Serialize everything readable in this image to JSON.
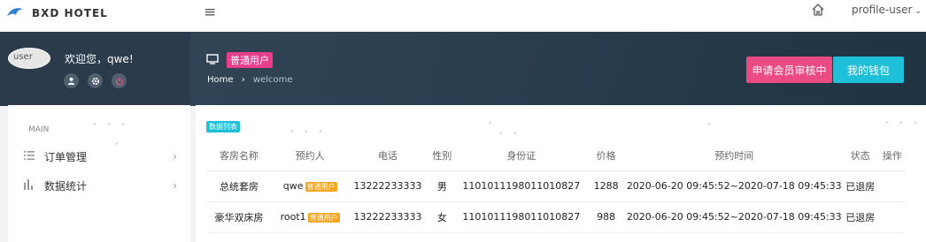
{
  "topbar": {
    "brand": "BXD HOTEL",
    "menu_icon": "hamburger-icon",
    "home_icon": "home-icon",
    "profile_label": "profile-user",
    "profile_chevron": "⌄"
  },
  "banner": {
    "avatar_alt": "user",
    "welcome": "欢迎您，qwe!",
    "icons": [
      "user-icon",
      "gear-icon",
      "power-icon"
    ],
    "role_badge": "普通用户",
    "breadcrumb_home": "Home",
    "breadcrumb_sep": "›",
    "breadcrumb_current": "welcome",
    "apply_button": "申请会员审核中",
    "wallet_button": "我的钱包"
  },
  "sidebar": {
    "caption": "MAIN",
    "items": [
      {
        "label": "订单管理",
        "icon": "list-icon"
      },
      {
        "label": "数据统计",
        "icon": "bar-chart-icon"
      }
    ]
  },
  "table": {
    "badge": "数据列表",
    "columns": [
      "客房名称",
      "预约人",
      "电话",
      "性别",
      "身份证",
      "价格",
      "预约时间",
      "状态",
      "操作"
    ],
    "rows": [
      {
        "room": "总统套房",
        "user": "qwe",
        "user_badge": "普通用户",
        "phone": "13222233333",
        "gender": "男",
        "id_card": "110101119801101082​7",
        "price": "1288",
        "time": "2020-06-20 09:45:52~2020-07-18 09:45:33",
        "status": "已退房",
        "action": ""
      },
      {
        "room": "豪华双床房",
        "user": "root1",
        "user_badge": "普通用户",
        "phone": "13222233333",
        "gender": "女",
        "id_card": "110101119801101082​7",
        "price": "988",
        "time": "2020-06-20 09:45:52~2020-07-18 09:45:33",
        "status": "已退房",
        "action": ""
      }
    ]
  },
  "colors": {
    "accent_pink": "#e83e8c",
    "accent_cyan": "#1ec0d9",
    "accent_orange": "#f7a51c",
    "banner_dark": "#2b3b4b"
  }
}
